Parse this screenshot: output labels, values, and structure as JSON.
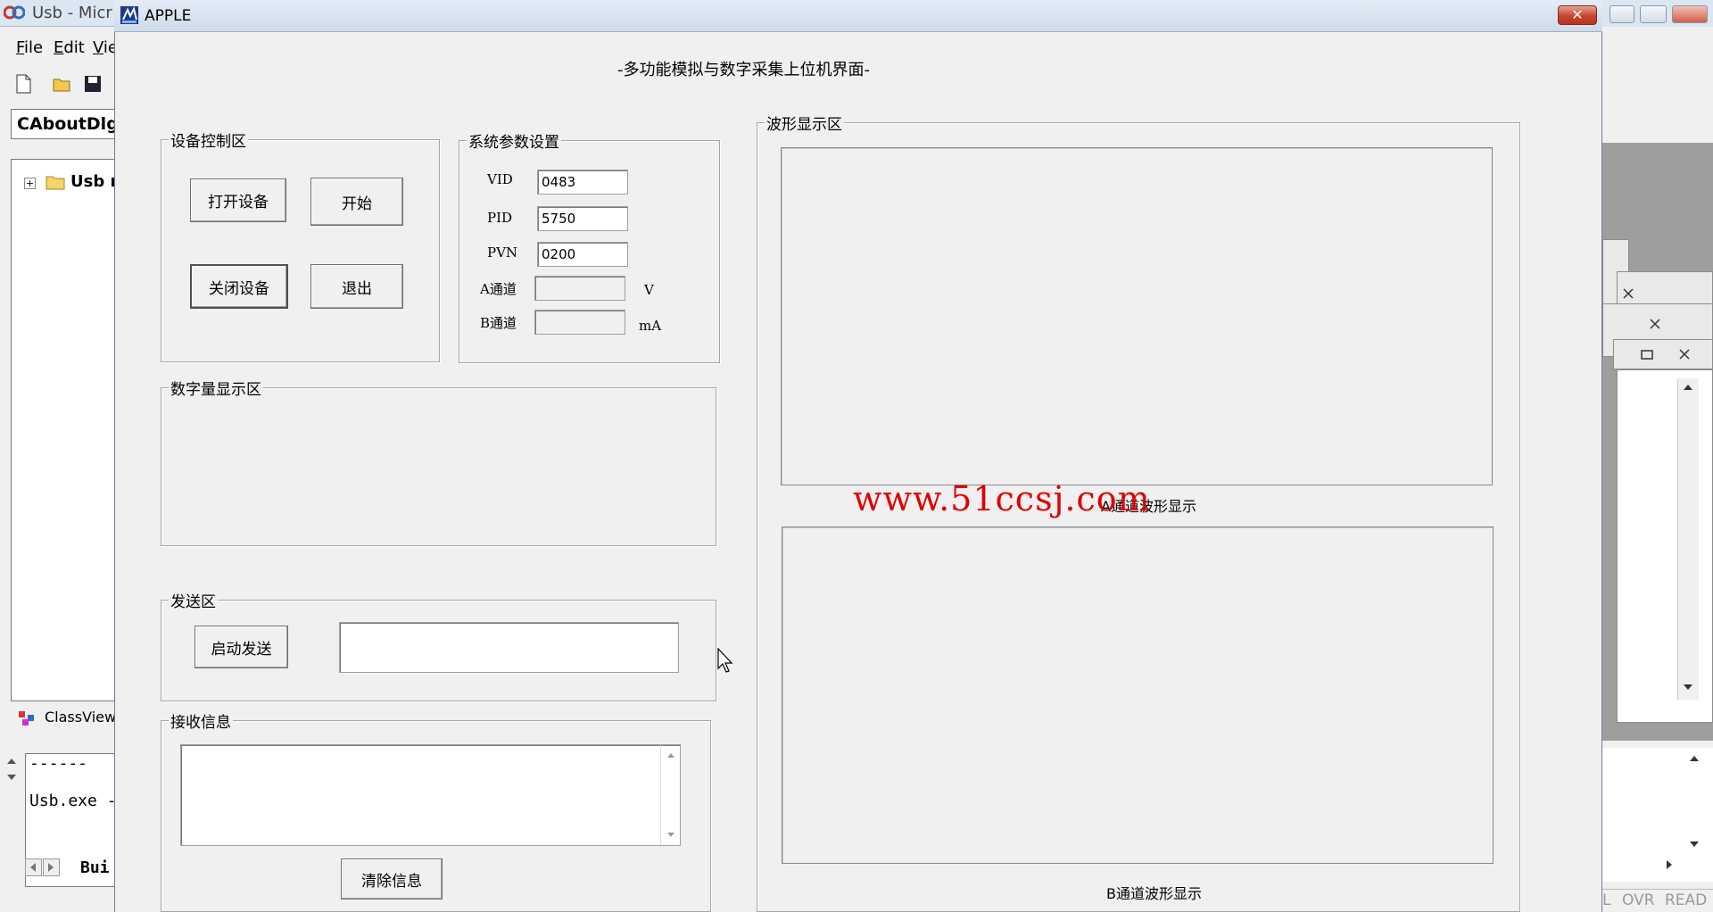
{
  "ide": {
    "title": "Usb - Micr",
    "menu": [
      "File",
      "Edit",
      "Vie"
    ],
    "class_combo": "CAboutDlg",
    "tree_root": "Usb r",
    "classview_tab": "ClassView",
    "output_dashes": "------",
    "output_line": "Usb.exe -",
    "output_tab": "Bui",
    "status": [
      "L",
      "OVR",
      "READ"
    ]
  },
  "dialog": {
    "title": "APPLE",
    "close_glyph": "✕",
    "main_title": "-多功能模拟与数字采集上位机界面-",
    "device_control": {
      "label": "设备控制区",
      "open_btn": "打开设备",
      "start_btn": "开始",
      "close_btn": "关闭设备",
      "exit_btn": "退出"
    },
    "sys_params": {
      "label": "系统参数设置",
      "vid_label": "VID",
      "vid_value": "0483",
      "pid_label": "PID",
      "pid_value": "5750",
      "pvn_label": "PVN",
      "pvn_value": "0200",
      "a_label": "A通道",
      "a_value": "",
      "a_unit": "V",
      "b_label": "B通道",
      "b_value": "",
      "b_unit": "mA"
    },
    "digital_display": {
      "label": "数字量显示区"
    },
    "send": {
      "label": "发送区",
      "start_btn": "启动发送",
      "input_value": ""
    },
    "receive": {
      "label": "接收信息",
      "text": "",
      "clear_btn": "清除信息"
    },
    "waveform": {
      "label": "波形显示区",
      "a_caption": "A通道波形显示",
      "b_caption": "B通道波形显示"
    }
  },
  "watermark": "www.51ccsj.com"
}
